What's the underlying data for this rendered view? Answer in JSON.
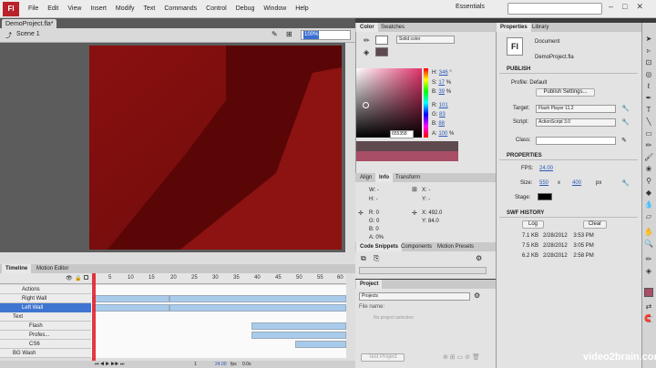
{
  "app": {
    "logo": "Fl",
    "menus": [
      "File",
      "Edit",
      "View",
      "Insert",
      "Modify",
      "Text",
      "Commands",
      "Control",
      "Debug",
      "Window",
      "Help"
    ],
    "workspace": "Essentials",
    "window_controls": [
      "–",
      "□",
      "✕"
    ]
  },
  "document": {
    "tab": "DemoProject.fla*",
    "scene": "Scene 1",
    "zoom": "100%"
  },
  "timeline": {
    "tabs": [
      "Timeline",
      "Motion Editor"
    ],
    "frame_numbers": [
      "1",
      "5",
      "10",
      "15",
      "20",
      "25",
      "30",
      "35",
      "40",
      "45",
      "50",
      "55",
      "60"
    ],
    "layers": [
      {
        "name": "Actions"
      },
      {
        "name": "Right Wall"
      },
      {
        "name": "Left Wall"
      },
      {
        "name": "Text"
      },
      {
        "name": "Flash"
      },
      {
        "name": "Profes..."
      },
      {
        "name": "CS6"
      },
      {
        "name": "BG Wash"
      }
    ],
    "footer": {
      "frame": "1",
      "fps": "24.00",
      "fps_unit": "fps",
      "time": "0.0s"
    }
  },
  "color_panel": {
    "tabs": [
      "Color",
      "Swatches"
    ],
    "type": "Solid color",
    "hsb": [
      {
        "k": "H:",
        "v": "346",
        "u": "°"
      },
      {
        "k": "S:",
        "v": "17",
        "u": "%"
      },
      {
        "k": "B:",
        "v": "39",
        "u": "%"
      }
    ],
    "rgb": [
      {
        "k": "R:",
        "v": "101"
      },
      {
        "k": "G:",
        "v": "83"
      },
      {
        "k": "B:",
        "v": "88"
      }
    ],
    "alpha": {
      "k": "A:",
      "v": "100",
      "u": "%"
    },
    "hex": "655358"
  },
  "info_panel": {
    "tabs": [
      "Align",
      "Info",
      "Transform"
    ],
    "W": "W:",
    "W_val": "-",
    "H": "H:",
    "H_val": "-",
    "X": "X:",
    "X_val": "-",
    "Y": "Y:",
    "Y_val": "-",
    "R": "R: 0",
    "G": "G: 0",
    "B": "B: 0",
    "A": "A: 0%",
    "X2": "X: 492.0",
    "Y2": "Y: 84.0"
  },
  "code_snippets": {
    "tabs": [
      "Code Snippets",
      "Components",
      "Motion Presets"
    ]
  },
  "project": {
    "tab": "Project",
    "dropdown": "Projects",
    "file_name": "File name:",
    "no_selection": "No project selection",
    "test_button": "Test Project"
  },
  "properties": {
    "tabs": [
      "Properties",
      "Library"
    ],
    "doc_type": "Document",
    "file": "DemoProject.fla",
    "publish": {
      "header": "PUBLISH",
      "profile_label": "Profile:",
      "profile": "Default",
      "settings_button": "Publish Settings...",
      "target_label": "Target:",
      "target": "Flash Player 11.2",
      "script_label": "Script:",
      "script": "ActionScript 3.0",
      "class_label": "Class:"
    },
    "properties": {
      "header": "PROPERTIES",
      "fps_label": "FPS:",
      "fps": "24.00",
      "size_label": "Size:",
      "width": "550",
      "x": "x",
      "height": "400",
      "unit": "px",
      "stage_label": "Stage:"
    },
    "swf_history": {
      "header": "SWF HISTORY",
      "log_button": "Log",
      "clear_button": "Clear",
      "rows": [
        {
          "size": "7.1 KB",
          "date": "2/28/2012",
          "time": "3:53 PM"
        },
        {
          "size": "7.5 KB",
          "date": "2/28/2012",
          "time": "3:05 PM"
        },
        {
          "size": "6.2 KB",
          "date": "2/28/2012",
          "time": "2:58 PM"
        }
      ]
    }
  },
  "brand": "video2brain.com"
}
